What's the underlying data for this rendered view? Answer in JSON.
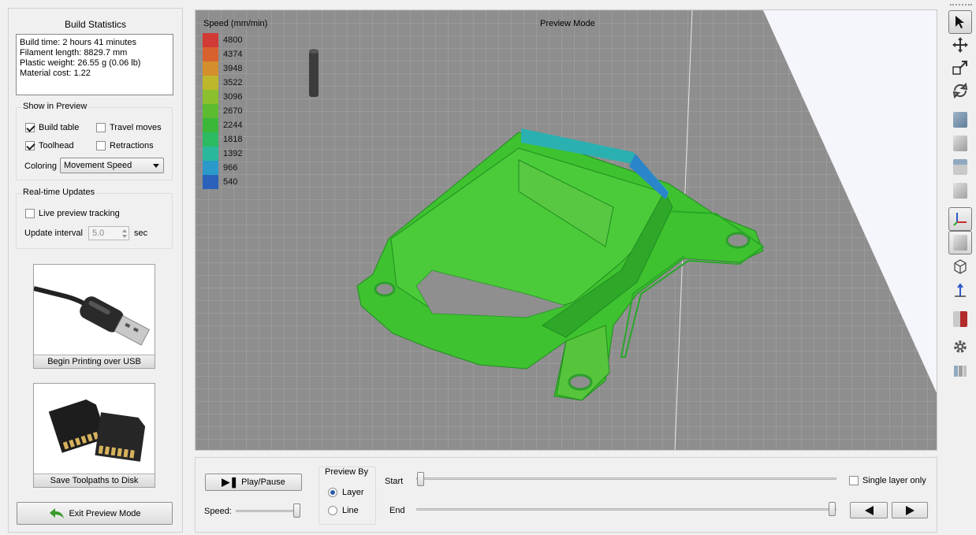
{
  "build_stats": {
    "title": "Build Statistics",
    "lines": [
      "Build time: 2 hours 41 minutes",
      "Filament length: 8829.7 mm",
      "Plastic weight: 26.55 g (0.06 lb)",
      "Material cost: 1.22"
    ]
  },
  "show_in_preview": {
    "title": "Show in Preview",
    "build_table": {
      "label": "Build table",
      "checked": true
    },
    "travel_moves": {
      "label": "Travel moves",
      "checked": false
    },
    "toolhead": {
      "label": "Toolhead",
      "checked": true
    },
    "retractions": {
      "label": "Retractions",
      "checked": false
    },
    "coloring_label": "Coloring",
    "coloring_value": "Movement Speed"
  },
  "realtime": {
    "title": "Real-time Updates",
    "live_label": "Live preview tracking",
    "live_checked": false,
    "interval_label": "Update interval",
    "interval_value": "5.0",
    "interval_unit": "sec"
  },
  "actions": {
    "usb_label": "Begin Printing over USB",
    "sd_label": "Save Toolpaths to Disk",
    "exit_label": "Exit Preview Mode"
  },
  "viewport": {
    "mode_label": "Preview Mode",
    "legend_title": "Speed (mm/min)",
    "legend": [
      {
        "value": "4800",
        "color": "#d23a35"
      },
      {
        "value": "4374",
        "color": "#d8622e"
      },
      {
        "value": "3948",
        "color": "#d48e2c"
      },
      {
        "value": "3522",
        "color": "#bcb72b"
      },
      {
        "value": "3096",
        "color": "#8cbf2d"
      },
      {
        "value": "2670",
        "color": "#5dbb30"
      },
      {
        "value": "2244",
        "color": "#3bb73a"
      },
      {
        "value": "1818",
        "color": "#2cba63"
      },
      {
        "value": "1392",
        "color": "#2ab89c"
      },
      {
        "value": "966",
        "color": "#2b99c9"
      },
      {
        "value": "540",
        "color": "#2a62b9"
      }
    ]
  },
  "playback": {
    "play_label": "Play/Pause",
    "speed_label": "Speed:",
    "preview_by_title": "Preview By",
    "layer_label": "Layer",
    "line_label": "Line",
    "preview_by_selected": "Layer",
    "start_label": "Start",
    "end_label": "End",
    "single_layer_label": "Single layer only",
    "single_layer_checked": false
  }
}
